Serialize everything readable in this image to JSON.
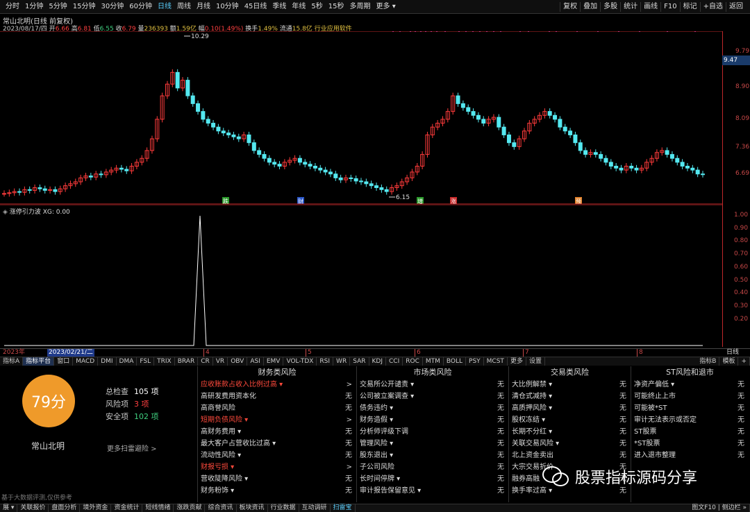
{
  "toolbar": {
    "periods": [
      "分时",
      "1分钟",
      "5分钟",
      "15分钟",
      "30分钟",
      "60分钟",
      "日线",
      "周线",
      "月线",
      "10分钟",
      "45日线",
      "季线",
      "年线",
      "5秒",
      "15秒",
      "多周期",
      "更多 ▾"
    ],
    "active_index": 6,
    "right": [
      "复权",
      "叠加",
      "多股",
      "统计",
      "画线",
      "F10",
      "标记",
      "+自选",
      "返回"
    ]
  },
  "info": {
    "title": "常山北明(日线 前复权)",
    "date": "2023/08/17/四",
    "open_label": "开",
    "open": "6.66",
    "high_label": "高",
    "high": "6.81",
    "low_label": "低",
    "low": "6.55",
    "close_label": "收",
    "close": "6.79",
    "vol_label": "量",
    "vol": "236393",
    "amt_label": "额",
    "amt": "1.59亿",
    "chg_label": "幅",
    "chg": "0.10(1.49%)",
    "turn_label": "换手",
    "turn": "1.49%",
    "float_label": "流通",
    "float": "15.8亿",
    "industry": "行业应用软件"
  },
  "price_axis": {
    "ticks": [
      "9.79",
      "8.90",
      "8.09",
      "7.36",
      "6.69"
    ],
    "current": "9.47"
  },
  "annotations": {
    "high": "10.29",
    "low": "6.15"
  },
  "event_tags": [
    "跌",
    "财",
    "增",
    "涨",
    "预"
  ],
  "indicator": {
    "name": "涨停引力波",
    "xg_label": "XG:",
    "xg": "0.00",
    "ticks": [
      "1.00",
      "0.90",
      "0.80",
      "0.70",
      "0.60",
      "0.50",
      "0.40",
      "0.30",
      "0.20"
    ]
  },
  "date_bar": {
    "year": "2023年",
    "cursor": "2023/02/21/二",
    "months": [
      "4",
      "5",
      "6",
      "7",
      "8"
    ],
    "right": "日线"
  },
  "ind_tabs": [
    "指标A",
    "指标平台",
    "窗口",
    "MACD",
    "DMI",
    "DMA",
    "FSL",
    "TRIX",
    "BRAR",
    "CR",
    "VR",
    "OBV",
    "ASI",
    "EMV",
    "VOL-TDX",
    "RSI",
    "WR",
    "SAR",
    "KDJ",
    "CCI",
    "ROC",
    "MTM",
    "BOLL",
    "PSY",
    "MCST",
    "更多",
    "设置"
  ],
  "ind_tabs_right": [
    "指标B",
    "模板",
    "+"
  ],
  "risk": {
    "score": "79分",
    "name": "常山北明",
    "stats": [
      {
        "label": "总检查",
        "value": "105 项"
      },
      {
        "label": "风险项",
        "value": "3 项"
      },
      {
        "label": "安全项",
        "value": "102 项"
      }
    ],
    "more": "更多扫雷避险 >",
    "disclaimer": "基于大数据评测,仅供参考",
    "columns": [
      {
        "title": "财务类风险",
        "rows": [
          {
            "name": "应收账款占收入比例过高 ▾",
            "result": ">",
            "hl": true
          },
          {
            "name": "高研发费用资本化",
            "result": "无",
            "hl": false
          },
          {
            "name": "高商誉风险",
            "result": "无",
            "hl": false
          },
          {
            "name": "短期负债风险 ▾",
            "result": ">",
            "hl": true
          },
          {
            "name": "高财务费用 ▾",
            "result": "无",
            "hl": false
          },
          {
            "name": "最大客户占营收比过高 ▾",
            "result": "无",
            "hl": false
          },
          {
            "name": "流动性风险 ▾",
            "result": "无",
            "hl": false
          },
          {
            "name": "财报亏损 ▾",
            "result": ">",
            "hl": true
          },
          {
            "name": "营收陡降风险 ▾",
            "result": "无",
            "hl": false
          },
          {
            "name": "财务粉饰 ▾",
            "result": "无",
            "hl": false
          }
        ]
      },
      {
        "title": "市场类风险",
        "rows": [
          {
            "name": "交易所公开谴责 ▾",
            "result": "无"
          },
          {
            "name": "公司被立案调查 ▾",
            "result": "无"
          },
          {
            "name": "债务违约 ▾",
            "result": "无"
          },
          {
            "name": "财务造假 ▾",
            "result": "无"
          },
          {
            "name": "分析师评级下调",
            "result": "无"
          },
          {
            "name": "管理风险 ▾",
            "result": "无"
          },
          {
            "name": "股东退出 ▾",
            "result": "无"
          },
          {
            "name": "子公司风险",
            "result": "无"
          },
          {
            "name": "长时间停牌 ▾",
            "result": "无"
          },
          {
            "name": "审计报告保留意见 ▾",
            "result": "无"
          }
        ]
      },
      {
        "title": "交易类风险",
        "rows": [
          {
            "name": "大比例解禁 ▾",
            "result": "无"
          },
          {
            "name": "清仓式减持 ▾",
            "result": "无"
          },
          {
            "name": "高质押风险 ▾",
            "result": "无"
          },
          {
            "name": "股权冻结 ▾",
            "result": "无"
          },
          {
            "name": "长期不分红 ▾",
            "result": "无"
          },
          {
            "name": "关联交易风险 ▾",
            "result": "无"
          },
          {
            "name": "北上资金卖出",
            "result": "无"
          },
          {
            "name": "大宗交易折价",
            "result": "无"
          },
          {
            "name": "融券高融",
            "result": "无"
          },
          {
            "name": "换手率过高 ▾",
            "result": "无"
          }
        ]
      },
      {
        "title": "ST风险和退市",
        "rows": [
          {
            "name": "净资产偏低 ▾",
            "result": "无"
          },
          {
            "name": "可能终止上市",
            "result": "无"
          },
          {
            "name": "可能被*ST",
            "result": "无"
          },
          {
            "name": "审计无法表示或否定",
            "result": "无"
          },
          {
            "name": "ST股票",
            "result": "无"
          },
          {
            "name": "*ST股票",
            "result": "无"
          },
          {
            "name": "进入退市整理",
            "result": "无"
          }
        ]
      }
    ]
  },
  "status_bar": [
    "展 ▾",
    "关联报价",
    "盘面分析",
    "境外资金",
    "资金统计",
    "短线情绪",
    "涨跌贡献",
    "综合资讯",
    "板块资讯",
    "行业数据",
    "互动调研",
    "扫雷宝"
  ],
  "status_right": "图文F10 | 侧边栏 »",
  "watermark": "股票指标源码分享",
  "colors": {
    "up": "#ff3b3b",
    "down": "#54e8f0",
    "accent": "#ef9a2a"
  }
}
